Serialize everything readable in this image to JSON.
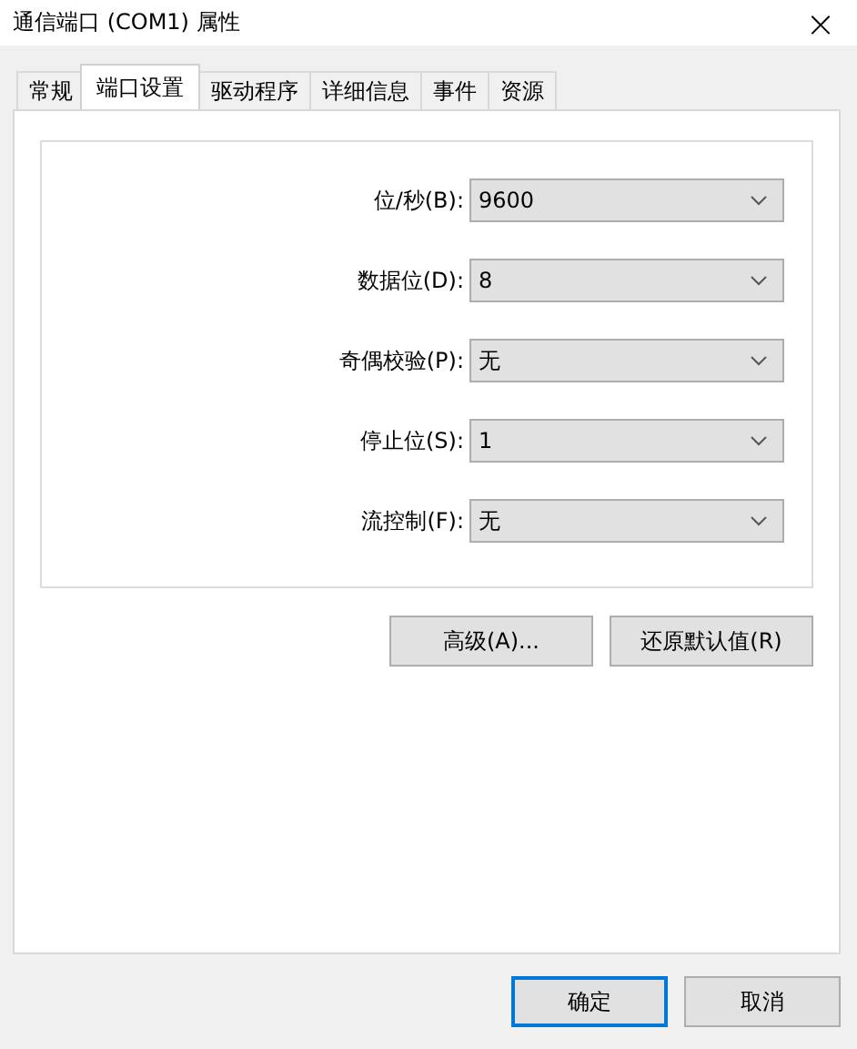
{
  "window": {
    "title": "通信端口 (COM1) 属性",
    "close": "×"
  },
  "tabs": [
    {
      "label": "常规",
      "selected": false
    },
    {
      "label": "端口设置",
      "selected": true
    },
    {
      "label": "驱动程序",
      "selected": false
    },
    {
      "label": "详细信息",
      "selected": false
    },
    {
      "label": "事件",
      "selected": false
    },
    {
      "label": "资源",
      "selected": false
    }
  ],
  "settings": [
    {
      "label": "位/秒(B):",
      "value": "9600"
    },
    {
      "label": "数据位(D):",
      "value": "8"
    },
    {
      "label": "奇偶校验(P):",
      "value": "无"
    },
    {
      "label": "停止位(S):",
      "value": "1"
    },
    {
      "label": "流控制(F):",
      "value": "无"
    }
  ],
  "panel_buttons": [
    "高级(A)...",
    "还原默认值(R)"
  ],
  "dialog_buttons": [
    {
      "label": "确定",
      "default": true
    },
    {
      "label": "取消",
      "default": false
    }
  ]
}
